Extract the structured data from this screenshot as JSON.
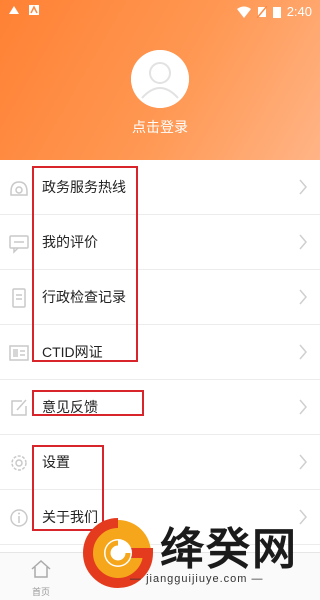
{
  "status_bar": {
    "time": "2:40"
  },
  "profile": {
    "login_text": "点击登录"
  },
  "menu": {
    "items": [
      {
        "label": "政务服务热线",
        "icon": "phone-icon"
      },
      {
        "label": "我的评价",
        "icon": "comment-icon"
      },
      {
        "label": "行政检查记录",
        "icon": "document-icon"
      },
      {
        "label": "CTID网证",
        "icon": "id-card-icon"
      },
      {
        "label": "意见反馈",
        "icon": "edit-icon"
      },
      {
        "label": "设置",
        "icon": "gear-icon"
      },
      {
        "label": "关于我们",
        "icon": "info-icon"
      }
    ]
  },
  "bottom_nav": {
    "home_label": "首页"
  },
  "watermark": {
    "name": "绛癸网",
    "url": "jiangguijiuye.com"
  },
  "colors": {
    "header_start": "#ff8134",
    "header_end": "#ffb486",
    "annotation_red": "#d8242b"
  }
}
